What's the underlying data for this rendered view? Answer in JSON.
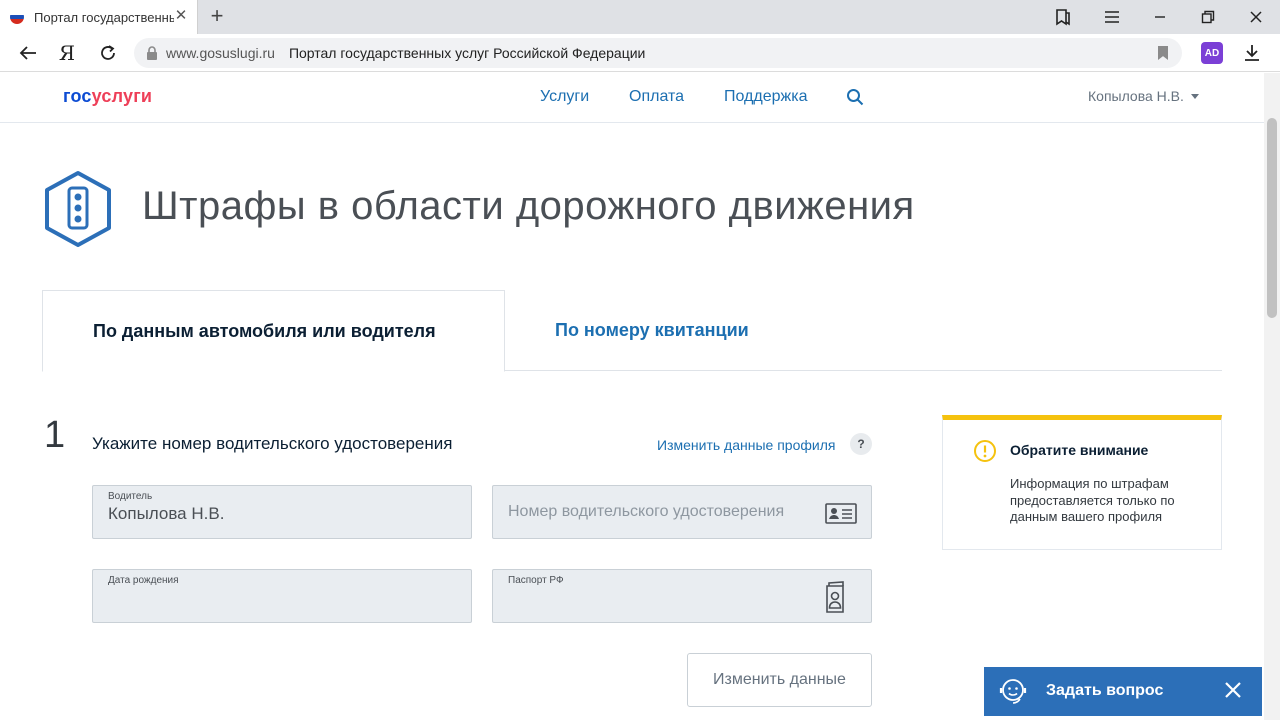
{
  "browser": {
    "tab_title": "Портал государственны",
    "tab_close": "✕",
    "new_tab": "+",
    "back": "←",
    "yandex": "Я",
    "reload": "↻",
    "url_host": "www.gosuslugi.ru",
    "url_title": "Портал государственных услуг Российской Федерации",
    "extension_label": "AD",
    "window_buttons": [
      "bookmarks-panel-icon",
      "menu-icon",
      "minimize-icon",
      "restore-icon",
      "close-window-icon"
    ]
  },
  "header": {
    "logo_part1": "гос",
    "logo_part2": "услуги",
    "nav": [
      "Услуги",
      "Оплата",
      "Поддержка"
    ],
    "user": "Копылова Н.В."
  },
  "page": {
    "title": "Штрафы в области дорожного движения",
    "tabs": [
      {
        "label": "По данным автомобиля или водителя",
        "active": true
      },
      {
        "label": "По номеру квитанции",
        "active": false
      }
    ],
    "step": {
      "number": "1",
      "title": "Укажите номер водительского удостоверения",
      "edit_link": "Изменить данные профиля",
      "help": "?"
    },
    "fields": {
      "driver": {
        "label": "Водитель",
        "value": "Копылова Н.В."
      },
      "license": {
        "placeholder": "Номер водительского удостоверения"
      },
      "birth": {
        "label": "Дата рождения",
        "value": ""
      },
      "passport": {
        "label": "Паспорт РФ",
        "value": ""
      }
    },
    "change_button": "Изменить данные"
  },
  "notice": {
    "title": "Обратите внимание",
    "text": "Информация по штрафам предоставляется только по данным вашего профиля",
    "accent": "#f5c20e"
  },
  "chat": {
    "label": "Задать вопрос",
    "color": "#2c6fb8"
  }
}
